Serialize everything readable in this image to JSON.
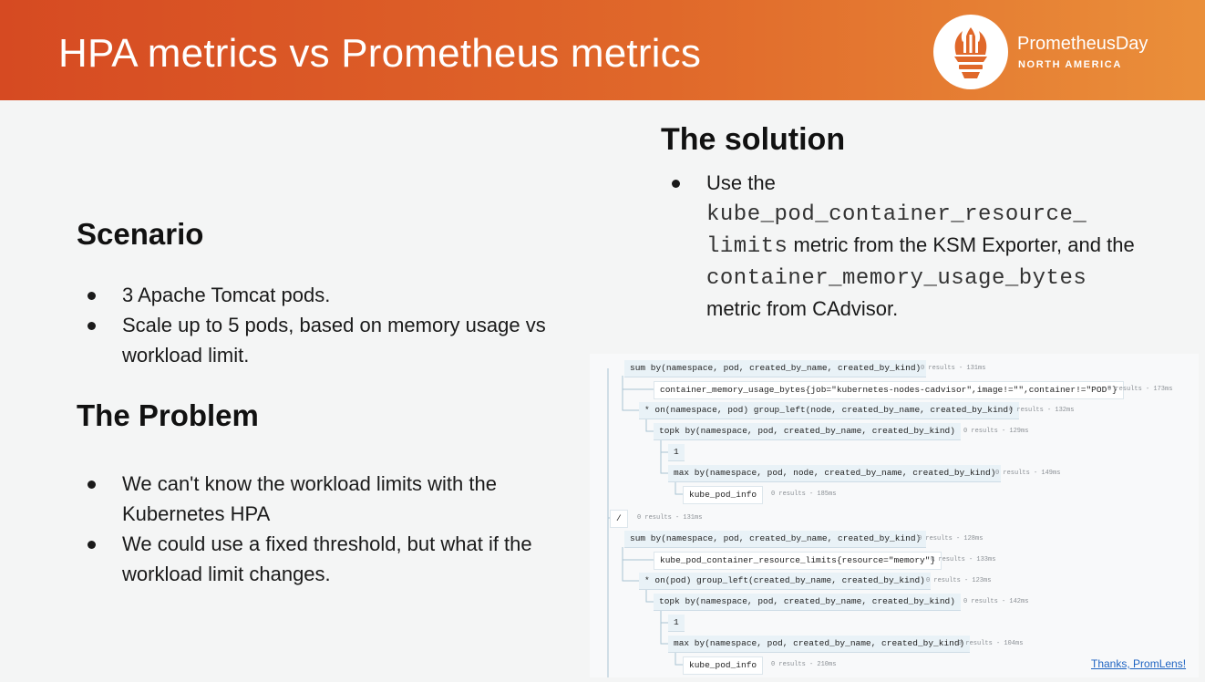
{
  "header": {
    "title": "HPA metrics vs Prometheus metrics",
    "logo_name": "PrometheusDay",
    "logo_sub": "NORTH AMERICA",
    "brand_color": "#e0682a"
  },
  "scenario": {
    "heading": "Scenario",
    "bullets": [
      "3 Apache Tomcat pods.",
      "Scale up to 5 pods, based on memory usage vs workload limit."
    ]
  },
  "problem": {
    "heading": "The Problem",
    "bullets": [
      "We can't know the workload limits with the Kubernetes HPA",
      "We could use a fixed threshold, but what if the workload limit changes."
    ]
  },
  "solution": {
    "heading": "The solution",
    "text_1": "Use the",
    "metric_1a": "kube_pod_container_resource_",
    "metric_1b": "limits",
    "text_2": " metric from the KSM Exporter, and the",
    "metric_2": "container_memory_usage_bytes",
    "text_3": "metric from CAdvisor."
  },
  "tree": {
    "nodes": [
      {
        "text": "sum by(namespace, pod, created_by_name, created_by_kind)",
        "meta": "0 results - 131ms"
      },
      {
        "text": "container_memory_usage_bytes{job=\"kubernetes-nodes-cadvisor\",image!=\"\",container!=\"POD\"}",
        "meta": "0 results - 173ms"
      },
      {
        "text": "* on(namespace, pod) group_left(node, created_by_name, created_by_kind)",
        "meta": "0 results - 132ms"
      },
      {
        "text": "topk by(namespace, pod, created_by_name, created_by_kind)",
        "meta": "0 results - 129ms"
      },
      {
        "text": "1",
        "meta": ""
      },
      {
        "text": "max by(namespace, pod, node, created_by_name, created_by_kind)",
        "meta": "0 results - 149ms"
      },
      {
        "text": "kube_pod_info",
        "meta": "0 results - 185ms"
      },
      {
        "text": "/",
        "meta": "0 results - 131ms"
      },
      {
        "text": "sum by(namespace, pod, created_by_name, created_by_kind)",
        "meta": "0 results - 128ms"
      },
      {
        "text": "kube_pod_container_resource_limits{resource=\"memory\"}",
        "meta": "0 results - 133ms"
      },
      {
        "text": "* on(pod) group_left(created_by_name, created_by_kind)",
        "meta": "0 results - 123ms"
      },
      {
        "text": "topk by(namespace, pod, created_by_name, created_by_kind)",
        "meta": "0 results - 142ms"
      },
      {
        "text": "1",
        "meta": ""
      },
      {
        "text": "max by(namespace, pod, created_by_name, created_by_kind)",
        "meta": "0 results - 104ms"
      },
      {
        "text": "kube_pod_info",
        "meta": "0 results - 210ms"
      }
    ],
    "thanks": "Thanks, PromLens!"
  }
}
